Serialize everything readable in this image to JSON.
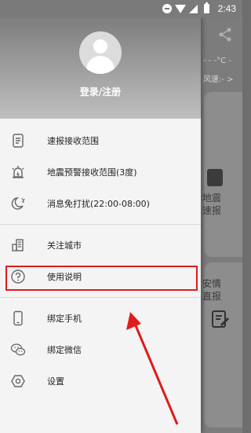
{
  "status_bar": {
    "time": "2:43"
  },
  "background": {
    "temp": "- - -°C -",
    "wind": "风速:- >",
    "card1": [
      "地震",
      "速报"
    ],
    "card2": [
      "安情",
      "直报"
    ]
  },
  "drawer": {
    "login_label": "登录/注册",
    "items": [
      {
        "label": "速报接收范围",
        "icon": "document-icon"
      },
      {
        "label": "地震预警接收范围(3度)",
        "icon": "alarm-icon"
      },
      {
        "label": "消息免打扰(22:00-08:00)",
        "icon": "moon-icon"
      },
      {
        "label": "关注城市",
        "icon": "city-icon"
      },
      {
        "label": "使用说明",
        "icon": "help-icon"
      },
      {
        "label": "绑定手机",
        "icon": "phone-icon"
      },
      {
        "label": "绑定微信",
        "icon": "wechat-icon"
      },
      {
        "label": "设置",
        "icon": "settings-icon"
      }
    ]
  },
  "colors": {
    "highlight": "#e01b1b",
    "arrow": "#e01b1b"
  }
}
